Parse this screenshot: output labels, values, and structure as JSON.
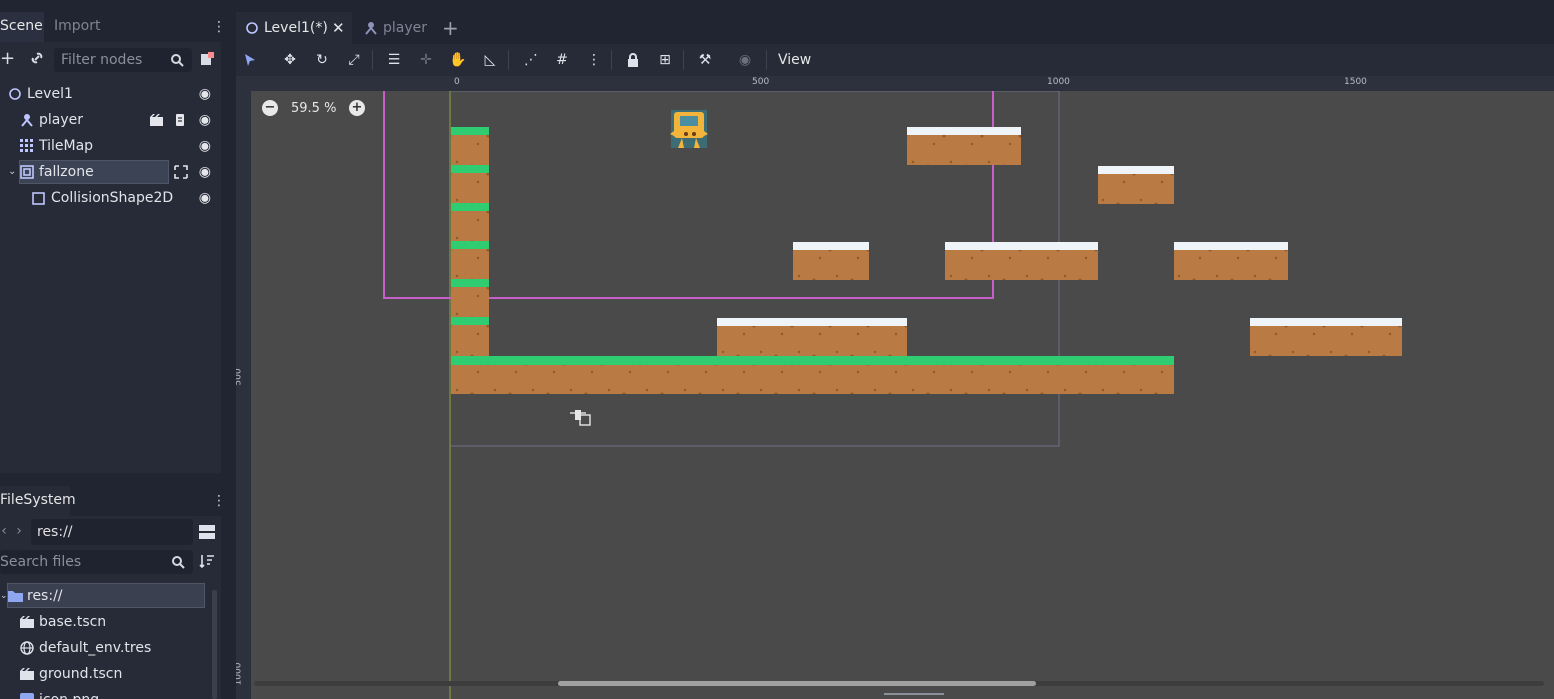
{
  "scene_dock": {
    "tabs": [
      "Scene",
      "Import"
    ],
    "filter_placeholder": "Filter nodes",
    "nodes": [
      {
        "label": "Level1",
        "icon": "node2d-icon"
      },
      {
        "label": "player",
        "icon": "kinematic-body-icon"
      },
      {
        "label": "TileMap",
        "icon": "tilemap-icon"
      },
      {
        "label": "fallzone",
        "icon": "area2d-icon"
      },
      {
        "label": "CollisionShape2D",
        "icon": "collision-shape-icon"
      }
    ]
  },
  "filesystem_dock": {
    "title": "FileSystem",
    "path": "res://",
    "search_placeholder": "Search files",
    "items": [
      {
        "label": "res://",
        "icon": "folder-icon"
      },
      {
        "label": "base.tscn",
        "icon": "scene-file-icon"
      },
      {
        "label": "default_env.tres",
        "icon": "environment-icon"
      },
      {
        "label": "ground.tscn",
        "icon": "scene-file-icon"
      },
      {
        "label": "icon.png",
        "icon": "image-file-icon"
      }
    ]
  },
  "editor_tabs": [
    {
      "label": "Level1(*)",
      "active": true
    },
    {
      "label": "player",
      "active": false
    }
  ],
  "toolbar": {
    "view_menu": "View"
  },
  "viewport": {
    "zoom": "59.5 %",
    "ruler_top": [
      "0",
      "500",
      "1000",
      "1500"
    ],
    "ruler_left": [
      "500",
      "1000"
    ]
  },
  "colors": {
    "grass": "#2fcc71",
    "dirt": "#b97a44",
    "snow": "#eef4f8",
    "fallzone_outline": "#c660c8",
    "canvas_bg": "#4a4a4a"
  }
}
